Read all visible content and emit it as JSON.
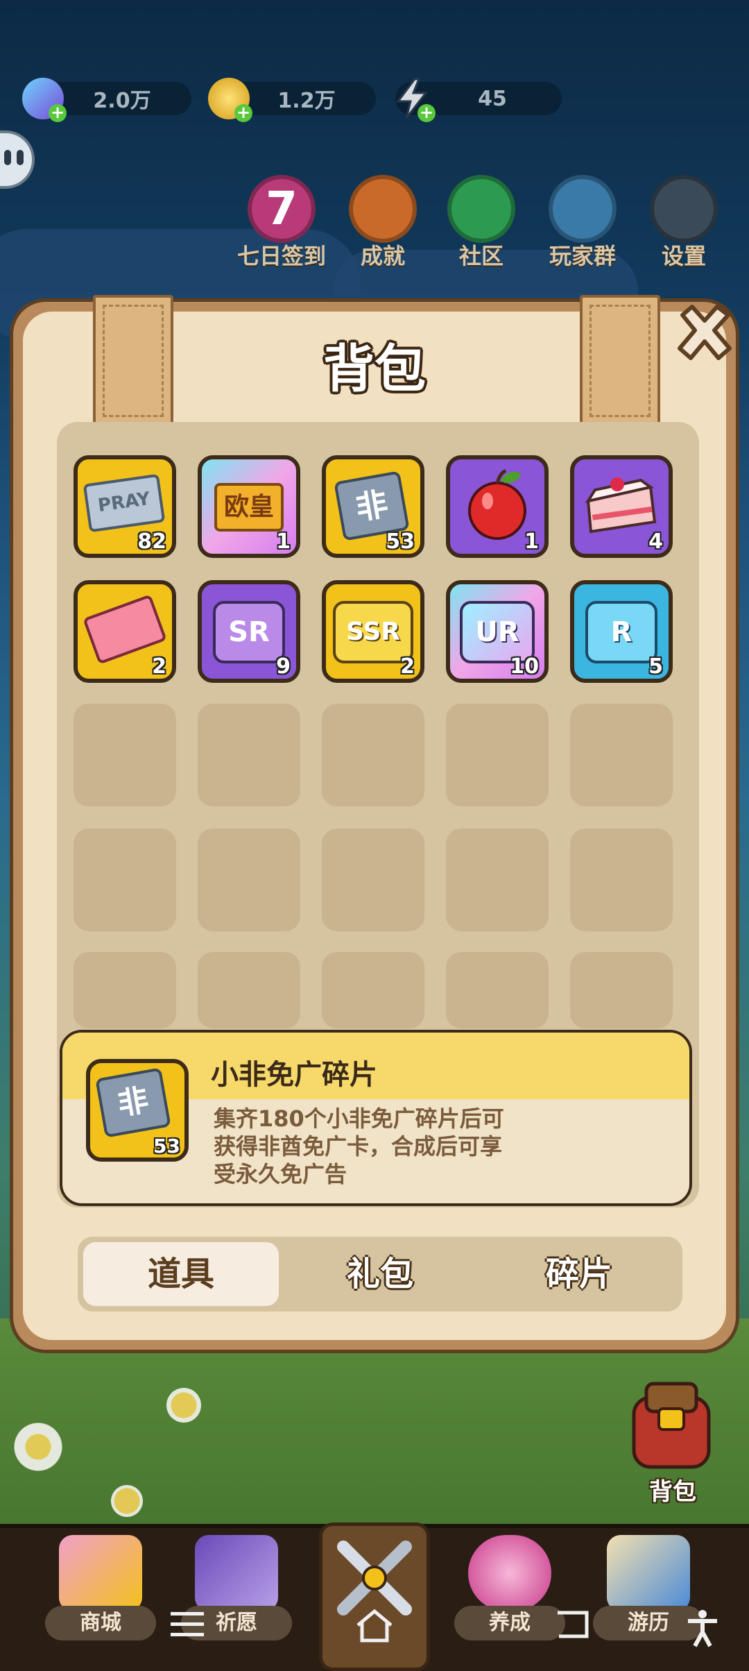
{
  "resources": [
    {
      "name": "diamond",
      "value": "2.0万",
      "icon": "diamond-icon"
    },
    {
      "name": "coin",
      "value": "1.2万",
      "icon": "coin-icon"
    },
    {
      "name": "energy",
      "value": "45",
      "icon": "lightning-icon"
    }
  ],
  "menu": [
    {
      "label": "七日签到",
      "badge": "7"
    },
    {
      "label": "成就"
    },
    {
      "label": "社区"
    },
    {
      "label": "玩家群"
    },
    {
      "label": "设置"
    }
  ],
  "panel": {
    "title": "背包",
    "items": [
      {
        "name": "pray-ticket",
        "text": "PRAY",
        "count": "82"
      },
      {
        "name": "ouhuang-card",
        "text": "欧皇",
        "count": "1"
      },
      {
        "name": "xiaofei-fragment",
        "text": "非",
        "count": "53"
      },
      {
        "name": "apple",
        "text": "",
        "count": "1"
      },
      {
        "name": "cake",
        "text": "",
        "count": "4"
      },
      {
        "name": "ticket",
        "text": "",
        "count": "2"
      },
      {
        "name": "sr-fragment",
        "text": "SR",
        "count": "9"
      },
      {
        "name": "ssr-fragment",
        "text": "SSR",
        "count": "2"
      },
      {
        "name": "ur-fragment",
        "text": "UR",
        "count": "10"
      },
      {
        "name": "r-fragment",
        "text": "R",
        "count": "5"
      }
    ],
    "detail": {
      "name": "小非免广碎片",
      "count": "53",
      "desc_line1": "集齐180个小非免广碎片后可",
      "desc_line2": "获得非酋免广卡，合成后可享",
      "desc_line3": "受永久免广告"
    },
    "tabs": [
      "道具",
      "礼包",
      "碎片"
    ]
  },
  "bag_button": "背包",
  "bottom_nav": [
    "商城",
    "祈愿",
    "养成",
    "游历"
  ]
}
